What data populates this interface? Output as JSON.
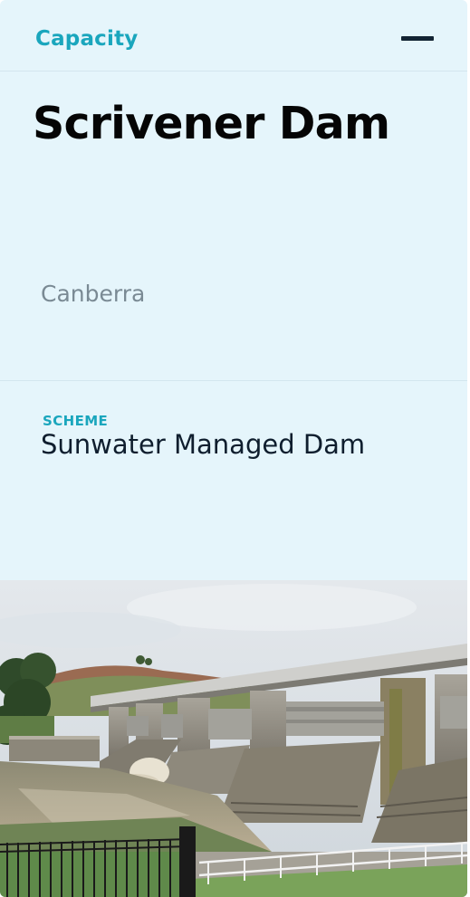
{
  "header": {
    "title": "Capacity",
    "menu_icon": "minus-icon"
  },
  "dam": {
    "name": "Scrivener Dam",
    "location": "Canberra"
  },
  "scheme": {
    "label": "SCHEME",
    "value": "Sunwater Managed Dam"
  },
  "photo": {
    "subject": "dam-spillway-photo"
  },
  "colors": {
    "accent": "#1aa6bd",
    "card_background": "#e5f5fb",
    "title_text": "#050505",
    "secondary_text": "#7a8a94"
  }
}
